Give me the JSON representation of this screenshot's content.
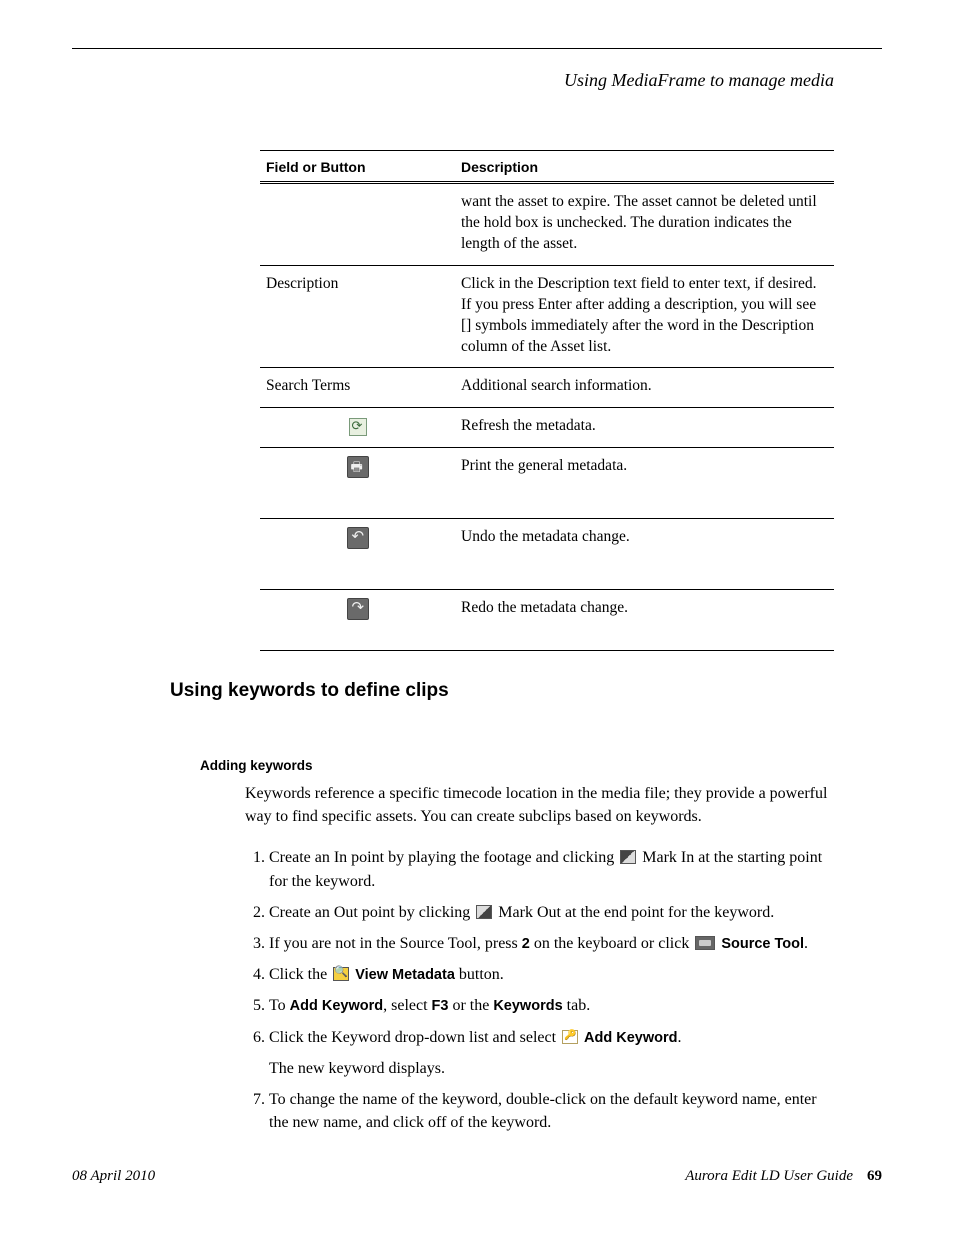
{
  "header": {
    "running_title": "Using MediaFrame to manage media"
  },
  "table": {
    "headers": {
      "col1": "Field or Button",
      "col2": "Description"
    },
    "rows": [
      {
        "field": "",
        "icon": null,
        "desc": "want the asset to expire. The asset cannot be deleted until the hold box is unchecked. The duration indicates the length of the asset."
      },
      {
        "field": "Description",
        "icon": null,
        "desc": "Click in the Description text field to enter text, if desired. If you press Enter after adding a description, you will see [] symbols immediately after the word in the Description column of the Asset list."
      },
      {
        "field": "Search Terms",
        "icon": null,
        "desc": "Additional search information."
      },
      {
        "field": "",
        "icon": "refresh",
        "desc": "Refresh the metadata."
      },
      {
        "field": "",
        "icon": "print",
        "desc": "Print the general metadata."
      },
      {
        "field": "",
        "icon": "undo",
        "desc": "Undo the metadata change."
      },
      {
        "field": "",
        "icon": "redo",
        "desc": "Redo the metadata change."
      }
    ]
  },
  "section": {
    "heading": "Using keywords to define clips",
    "subheading": "Adding keywords",
    "intro": "Keywords reference a specific timecode location in the media file; they provide a powerful way to find specific assets. You can create subclips based on keywords.",
    "steps": {
      "s1a": "Create an In point by playing the footage and clicking ",
      "s1b": " Mark In at the starting point for the keyword.",
      "s2a": "Create an Out point by clicking ",
      "s2b": " Mark Out at the end point for the keyword.",
      "s3a": "If you are not in the Source Tool, press ",
      "s3_key": "2",
      "s3b": " on the keyboard or click ",
      "s3_label": "Source Tool",
      "s3c": ".",
      "s4a": "Click the ",
      "s4_label": "View Metadata",
      "s4b": " button.",
      "s5a": "To ",
      "s5_label1": "Add Keyword",
      "s5b": ", select ",
      "s5_label2": "F3",
      "s5c": " or the ",
      "s5_label3": "Keywords",
      "s5d": " tab.",
      "s6a": "Click the Keyword drop-down list and select ",
      "s6_label": "Add Keyword",
      "s6b": ".",
      "s6_after": "The new keyword displays.",
      "s7": "To change the name of the keyword, double-click on the default keyword name, enter the new name, and click off of the keyword."
    }
  },
  "footer": {
    "date": "08 April 2010",
    "book": "Aurora Edit LD User Guide",
    "page": "69"
  }
}
